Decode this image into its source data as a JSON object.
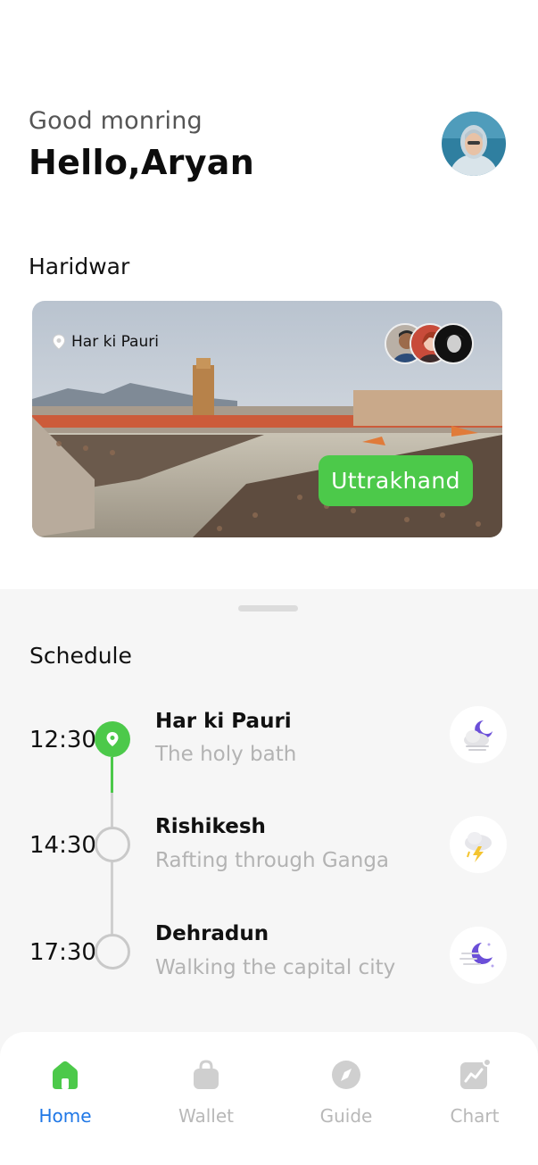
{
  "header": {
    "greeting": "Good monring",
    "name": "Hello,Aryan"
  },
  "featured": {
    "city": "Haridwar",
    "location": "Har ki Pauri",
    "region": "Uttrakhand"
  },
  "schedule": {
    "title": "Schedule",
    "items": [
      {
        "time": "12:30",
        "place": "Har ki Pauri",
        "description": "The holy bath",
        "weather_icon": "night-cloudy-icon",
        "active": true
      },
      {
        "time": "14:30",
        "place": "Rishikesh",
        "description": "Rafting through Ganga",
        "weather_icon": "thunderstorm-icon",
        "active": false
      },
      {
        "time": "17:30",
        "place": "Dehradun",
        "description": "Walking the capital city",
        "weather_icon": "windy-night-icon",
        "active": false
      }
    ]
  },
  "nav": {
    "items": [
      {
        "label": "Home",
        "icon": "home-icon",
        "active": true
      },
      {
        "label": "Wallet",
        "icon": "wallet-icon",
        "active": false
      },
      {
        "label": "Guide",
        "icon": "compass-icon",
        "active": false
      },
      {
        "label": "Chart",
        "icon": "chart-icon",
        "active": false
      }
    ]
  },
  "colors": {
    "accent_green": "#4cc94a",
    "nav_active_blue": "#1f77e6",
    "muted_text": "#b3b3b3"
  }
}
